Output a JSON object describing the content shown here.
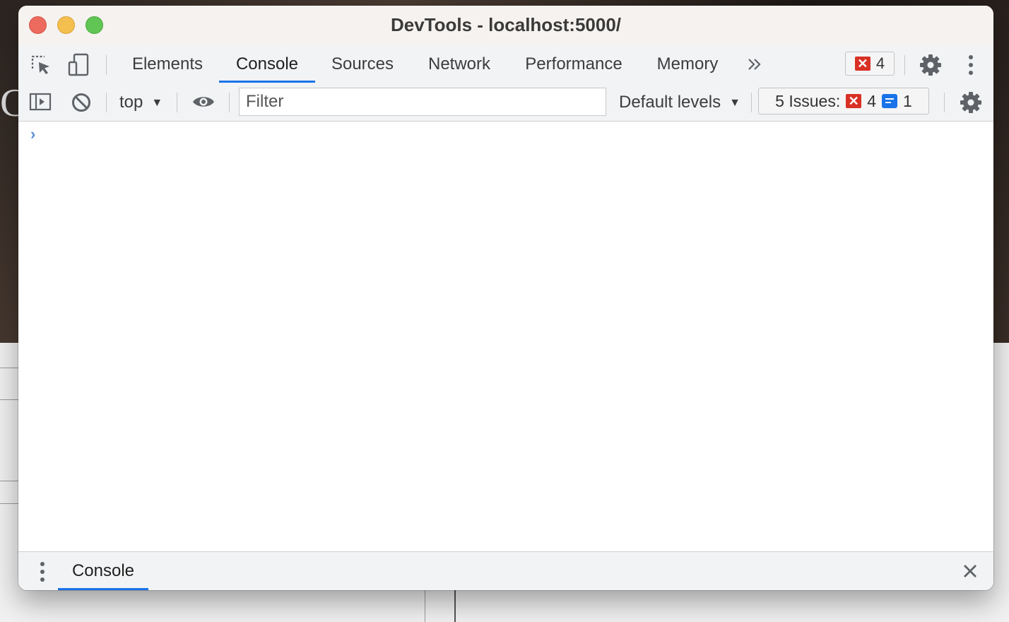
{
  "window": {
    "title": "DevTools - localhost:5000/"
  },
  "tabs": [
    {
      "label": "Elements",
      "active": false
    },
    {
      "label": "Console",
      "active": true
    },
    {
      "label": "Sources",
      "active": false
    },
    {
      "label": "Network",
      "active": false
    },
    {
      "label": "Performance",
      "active": false
    },
    {
      "label": "Memory",
      "active": false
    }
  ],
  "tabbar": {
    "more_tabs_icon": "double-chevron-right",
    "error_count": "4"
  },
  "toolbar": {
    "context": "top",
    "filter_placeholder": "Filter",
    "levels_label": "Default levels",
    "issues_label": "5 Issues:",
    "issues_errors": "4",
    "issues_info": "1"
  },
  "console": {
    "prompt_symbol": "›"
  },
  "drawer": {
    "tab_label": "Console"
  },
  "colors": {
    "accent": "#1a73e8",
    "error": "#d93025",
    "prompt": "#5b8fd6"
  }
}
